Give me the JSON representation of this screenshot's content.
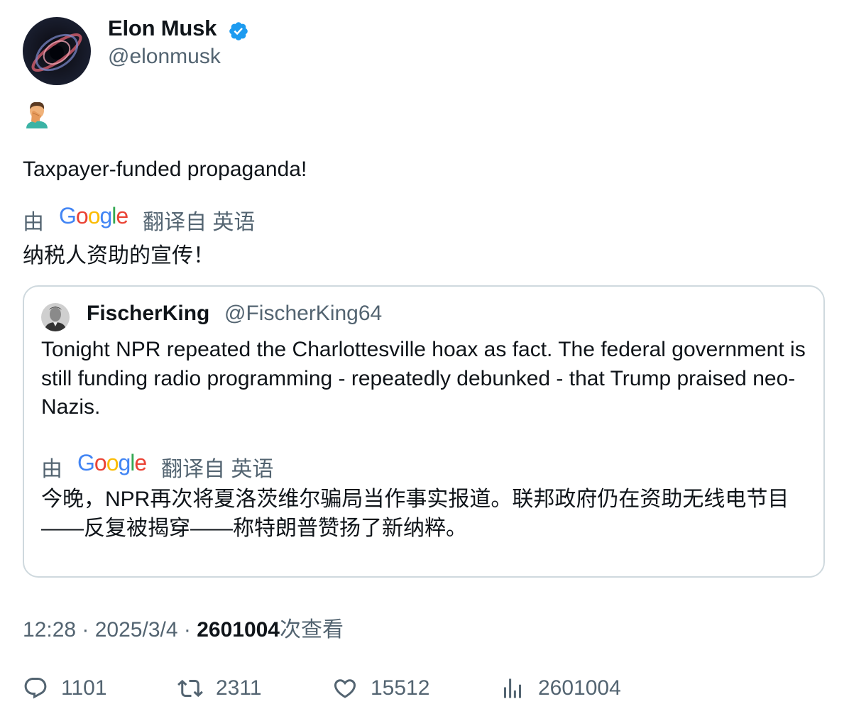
{
  "author": {
    "name": "Elon Musk",
    "handle": "@elonmusk",
    "verified": true,
    "verified_color": "#1d9bf0"
  },
  "post": {
    "emoji": "🤦‍♂️",
    "text": "Taxpayer-funded propaganda!",
    "translation": {
      "prefix": "由",
      "provider": "Google",
      "suffix": "翻译自 英语",
      "text": "纳税人资助的宣传！"
    }
  },
  "quote": {
    "name": "FischerKing",
    "handle": "@FischerKing64",
    "text": "Tonight NPR repeated the Charlottesville hoax as fact. The federal government is still funding radio programming - repeatedly debunked - that Trump praised neo-Nazis.",
    "translation": {
      "prefix": "由",
      "provider": "Google",
      "suffix": "翻译自 英语",
      "text": "今晚，NPR再次将夏洛茨维尔骗局当作事实报道。联邦政府仍在资助无线电节目——反复被揭穿——称特朗普赞扬了新纳粹。"
    }
  },
  "meta": {
    "time": "12:28",
    "sep1": " · ",
    "date": "2025/3/4",
    "sep2": " · ",
    "views": "2601004",
    "views_suffix": "次查看"
  },
  "actions": {
    "replies": "1101",
    "reposts": "2311",
    "likes": "15512",
    "views": "2601004"
  },
  "colors": {
    "text": "#0f1419",
    "secondary": "#536471",
    "border": "#cfd9de"
  }
}
